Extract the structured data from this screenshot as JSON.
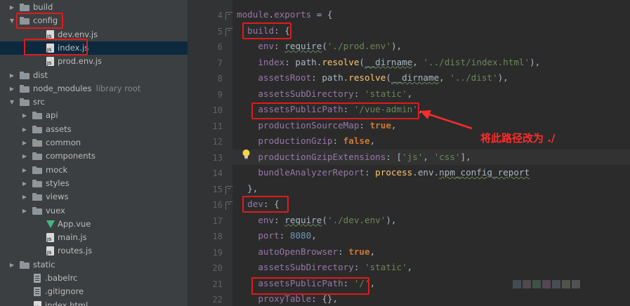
{
  "tree": [
    {
      "label": "build",
      "type": "folder",
      "depth": 0,
      "open": false,
      "selected": false
    },
    {
      "label": "config",
      "type": "folder",
      "depth": 0,
      "open": true,
      "selected": false
    },
    {
      "label": "dev.env.js",
      "type": "js",
      "depth": 1,
      "selected": false
    },
    {
      "label": "index.js",
      "type": "js",
      "depth": 1,
      "selected": true
    },
    {
      "label": "prod.env.js",
      "type": "js",
      "depth": 1,
      "selected": false
    },
    {
      "label": "dist",
      "type": "folder",
      "depth": 0,
      "open": false,
      "selected": false
    },
    {
      "label": "node_modules",
      "sub": "library root",
      "type": "folder",
      "depth": 0,
      "open": false,
      "selected": false
    },
    {
      "label": "src",
      "type": "folder",
      "depth": 0,
      "open": true,
      "selected": false
    },
    {
      "label": "api",
      "type": "folder",
      "depth": 1,
      "open": false,
      "selected": false
    },
    {
      "label": "assets",
      "type": "folder",
      "depth": 1,
      "open": false,
      "selected": false
    },
    {
      "label": "common",
      "type": "folder",
      "depth": 1,
      "open": false,
      "selected": false
    },
    {
      "label": "components",
      "type": "folder",
      "depth": 1,
      "open": false,
      "selected": false
    },
    {
      "label": "mock",
      "type": "folder",
      "depth": 1,
      "open": false,
      "selected": false
    },
    {
      "label": "styles",
      "type": "folder",
      "depth": 1,
      "open": false,
      "selected": false
    },
    {
      "label": "views",
      "type": "folder",
      "depth": 1,
      "open": false,
      "selected": false
    },
    {
      "label": "vuex",
      "type": "folder",
      "depth": 1,
      "open": false,
      "selected": false
    },
    {
      "label": "App.vue",
      "type": "vue",
      "depth": 1,
      "selected": false
    },
    {
      "label": "main.js",
      "type": "js",
      "depth": 1,
      "selected": false
    },
    {
      "label": "routes.js",
      "type": "js",
      "depth": 1,
      "selected": false
    },
    {
      "label": "static",
      "type": "folder",
      "depth": 0,
      "open": false,
      "selected": false
    },
    {
      "label": ".babelrc",
      "type": "cfg",
      "depth": 0,
      "selected": false
    },
    {
      "label": ".gitignore",
      "type": "cfg",
      "depth": 0,
      "selected": false
    },
    {
      "label": "index.html",
      "type": "js",
      "depth": 0,
      "selected": false
    }
  ],
  "editor": {
    "lines": [
      {
        "num": "4",
        "fold": true,
        "tokens": [
          [
            "k",
            "module"
          ],
          [
            "",
            "."
          ],
          [
            "k",
            "exports"
          ],
          [
            "",
            " = {"
          ]
        ]
      },
      {
        "num": "5",
        "fold": true,
        "tokens": [
          [
            "",
            "  "
          ],
          [
            "k",
            "build"
          ],
          [
            "",
            ": {"
          ]
        ]
      },
      {
        "num": "6",
        "tokens": [
          [
            "",
            "    "
          ],
          [
            "k",
            "env"
          ],
          [
            "",
            ": "
          ],
          [
            "u",
            "require"
          ],
          [
            "",
            "("
          ],
          [
            "s",
            "'./prod.env'"
          ],
          [
            "",
            "),"
          ]
        ]
      },
      {
        "num": "7",
        "tokens": [
          [
            "",
            "    "
          ],
          [
            "k",
            "index"
          ],
          [
            "",
            ": path."
          ],
          [
            "fn",
            "resolve"
          ],
          [
            "",
            "("
          ],
          [
            "u",
            "__dirname"
          ],
          [
            "",
            ", "
          ],
          [
            "s",
            "'../dist/index.html'"
          ],
          [
            "",
            "),"
          ]
        ]
      },
      {
        "num": "8",
        "tokens": [
          [
            "",
            "    "
          ],
          [
            "k",
            "assetsRoot"
          ],
          [
            "",
            ": path."
          ],
          [
            "fn",
            "resolve"
          ],
          [
            "",
            "("
          ],
          [
            "u",
            "__dirname"
          ],
          [
            "",
            ", "
          ],
          [
            "s",
            "'../dist'"
          ],
          [
            "",
            "),"
          ]
        ]
      },
      {
        "num": "9",
        "tokens": [
          [
            "",
            "    "
          ],
          [
            "k",
            "assetsSubDirectory"
          ],
          [
            "",
            ": "
          ],
          [
            "s",
            "'static'"
          ],
          [
            "",
            ","
          ]
        ]
      },
      {
        "num": "10",
        "tokens": [
          [
            "",
            "    "
          ],
          [
            "k",
            "assetsPublicPath"
          ],
          [
            "",
            ": "
          ],
          [
            "s",
            "'/vue-admin'"
          ],
          [
            "",
            ","
          ]
        ]
      },
      {
        "num": "11",
        "tokens": [
          [
            "",
            "    "
          ],
          [
            "k",
            "productionSourceMap"
          ],
          [
            "",
            ": "
          ],
          [
            "kw",
            "true"
          ],
          [
            "",
            ","
          ]
        ]
      },
      {
        "num": "12",
        "tokens": [
          [
            "",
            "    "
          ],
          [
            "k",
            "productionGzip"
          ],
          [
            "",
            ": "
          ],
          [
            "kw",
            "false"
          ],
          [
            "",
            ","
          ]
        ]
      },
      {
        "num": "13",
        "hl": true,
        "tokens": [
          [
            "",
            "    "
          ],
          [
            "k",
            "productionGzipExtensions"
          ],
          [
            "",
            ": ["
          ],
          [
            "s",
            "'js'"
          ],
          [
            "",
            ", "
          ],
          [
            "s",
            "'css'"
          ],
          [
            "",
            "],"
          ]
        ]
      },
      {
        "num": "14",
        "tokens": [
          [
            "",
            "    "
          ],
          [
            "k",
            "bundleAnalyzerReport"
          ],
          [
            "",
            ": "
          ],
          [
            "fn",
            "process"
          ],
          [
            "",
            ".env."
          ],
          [
            "u",
            "npm_config_report"
          ]
        ]
      },
      {
        "num": "15",
        "fold": true,
        "tokens": [
          [
            "",
            "  },"
          ]
        ]
      },
      {
        "num": "16",
        "fold": true,
        "tokens": [
          [
            "",
            "  "
          ],
          [
            "k",
            "dev"
          ],
          [
            "",
            ": {"
          ]
        ]
      },
      {
        "num": "17",
        "tokens": [
          [
            "",
            "    "
          ],
          [
            "k",
            "env"
          ],
          [
            "",
            ": "
          ],
          [
            "u",
            "require"
          ],
          [
            "",
            "("
          ],
          [
            "s",
            "'./dev.env'"
          ],
          [
            "",
            "),"
          ]
        ]
      },
      {
        "num": "18",
        "tokens": [
          [
            "",
            "    "
          ],
          [
            "k",
            "port"
          ],
          [
            "",
            ": "
          ],
          [
            "n",
            "8080"
          ],
          [
            "",
            ","
          ]
        ]
      },
      {
        "num": "19",
        "tokens": [
          [
            "",
            "    "
          ],
          [
            "k",
            "autoOpenBrowser"
          ],
          [
            "",
            ": "
          ],
          [
            "kw",
            "true"
          ],
          [
            "",
            ","
          ]
        ]
      },
      {
        "num": "20",
        "tokens": [
          [
            "",
            "    "
          ],
          [
            "k",
            "assetsSubDirectory"
          ],
          [
            "",
            ": "
          ],
          [
            "s",
            "'static'"
          ],
          [
            "",
            ","
          ]
        ]
      },
      {
        "num": "21",
        "tokens": [
          [
            "",
            "    "
          ],
          [
            "k",
            "assetsPublicPath"
          ],
          [
            "",
            ": "
          ],
          [
            "s",
            "'/'"
          ],
          [
            "",
            ","
          ]
        ]
      },
      {
        "num": "22",
        "tokens": [
          [
            "",
            "    "
          ],
          [
            "k",
            "proxyTable"
          ],
          [
            "",
            ": {},"
          ]
        ]
      }
    ]
  },
  "annotation": {
    "text": "将此路径改为 ./",
    "color": "#ff2b2b"
  },
  "colors": {
    "highlight_box": "#e01b1b",
    "tree_bg": "#3c3f41",
    "editor_bg": "#2b2b2b",
    "selection": "#0d293e"
  },
  "icons": {
    "hint": "lightbulb-icon",
    "folder": "folder-icon",
    "js": "js-file-icon",
    "vue": "vue-file-icon"
  }
}
